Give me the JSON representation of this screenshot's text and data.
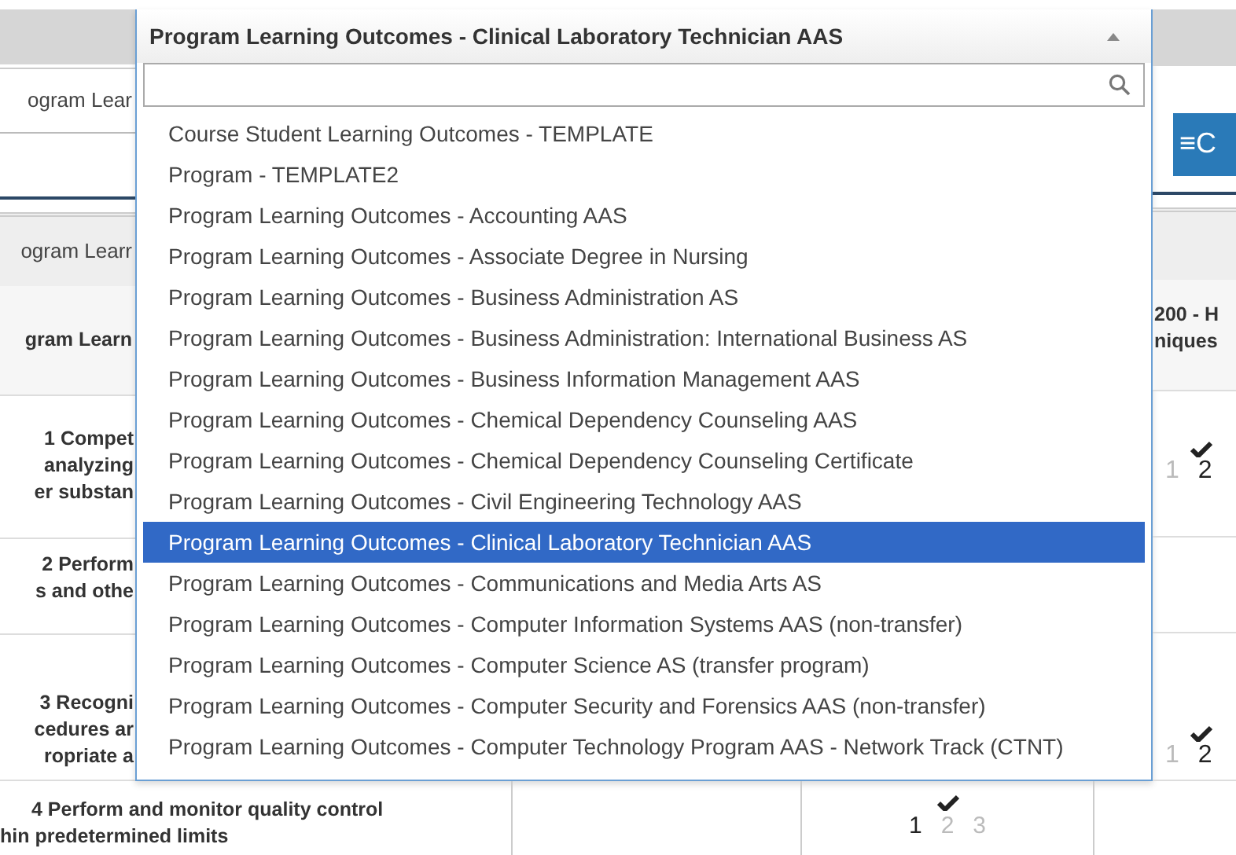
{
  "background": {
    "filter_field": "ogram Lear",
    "menu_button": "≡C",
    "table_header": "ogram Learr",
    "left_column_header": "gram Learn",
    "right_column_header": [
      "200 - H",
      "niques"
    ],
    "rows": [
      {
        "lines": [
          "1 Compet",
          "analyzing",
          "er substan"
        ],
        "checked": true,
        "scores": [
          {
            "label": "1",
            "selected": false
          },
          {
            "label": "2",
            "selected": true
          }
        ]
      },
      {
        "lines": [
          "2 Perform",
          "s and othe"
        ],
        "checked": false,
        "scores": []
      },
      {
        "lines": [
          "3 Recogni",
          "cedures ar",
          "ropriate a"
        ],
        "checked": true,
        "scores": [
          {
            "label": "1",
            "selected": false
          },
          {
            "label": "2",
            "selected": true
          }
        ]
      }
    ],
    "last_row": {
      "lines": [
        "4 Perform and monitor quality control",
        "hin predetermined limits"
      ],
      "checked": true,
      "scores": [
        {
          "label": "1",
          "selected": true
        },
        {
          "label": "2",
          "selected": false
        },
        {
          "label": "3",
          "selected": false
        }
      ]
    }
  },
  "dropdown": {
    "value": "Program Learning Outcomes - Clinical Laboratory Technician AAS",
    "expanded": true,
    "options": [
      {
        "label": "Course Student Learning Outcomes - TEMPLATE",
        "selected": false
      },
      {
        "label": "Program - TEMPLATE2",
        "selected": false
      },
      {
        "label": "Program Learning Outcomes - Accounting AAS",
        "selected": false
      },
      {
        "label": "Program Learning Outcomes - Associate Degree in Nursing",
        "selected": false
      },
      {
        "label": "Program Learning Outcomes - Business Administration AS",
        "selected": false
      },
      {
        "label": "Program Learning Outcomes - Business Administration: International Business AS",
        "selected": false
      },
      {
        "label": "Program Learning Outcomes - Business Information Management AAS",
        "selected": false
      },
      {
        "label": "Program Learning Outcomes - Chemical Dependency Counseling AAS",
        "selected": false
      },
      {
        "label": "Program Learning Outcomes - Chemical Dependency Counseling Certificate",
        "selected": false
      },
      {
        "label": "Program Learning Outcomes - Civil Engineering Technology AAS",
        "selected": false
      },
      {
        "label": "Program Learning Outcomes - Clinical Laboratory Technician AAS",
        "selected": true
      },
      {
        "label": "Program Learning Outcomes - Communications and Media Arts AS",
        "selected": false
      },
      {
        "label": "Program Learning Outcomes - Computer Information Systems AAS (non-transfer)",
        "selected": false
      },
      {
        "label": "Program Learning Outcomes - Computer Science AS (transfer program)",
        "selected": false
      },
      {
        "label": "Program Learning Outcomes - Computer Security and Forensics AAS (non-transfer)",
        "selected": false
      },
      {
        "label": "Program Learning Outcomes - Computer Technology Program AAS - Network Track (CTNT)",
        "selected": false
      }
    ]
  }
}
